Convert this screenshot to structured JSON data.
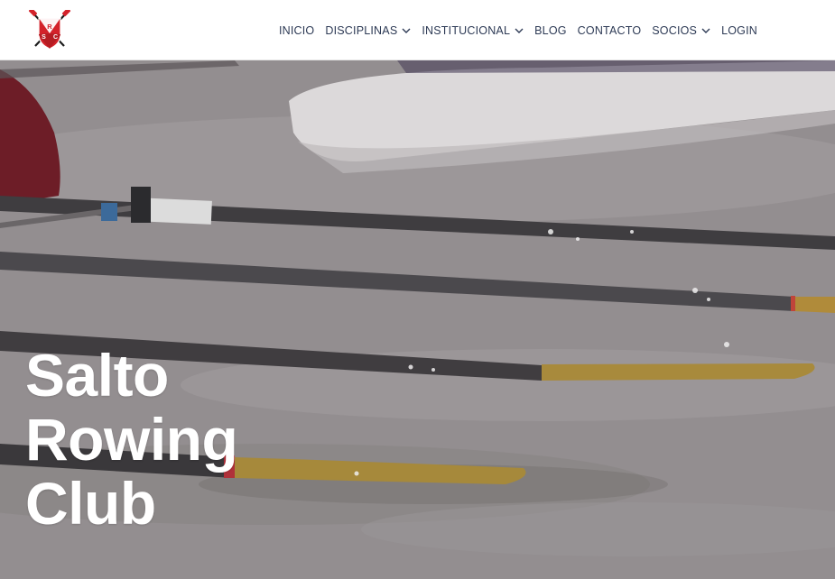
{
  "brand": {
    "logo_letters": [
      "S",
      "R",
      "C"
    ],
    "colors": {
      "red": "#d3222a",
      "dark": "#1c1c1c"
    }
  },
  "nav": {
    "items": [
      {
        "label": "INICIO",
        "dropdown": false
      },
      {
        "label": "DISCIPLINAS",
        "dropdown": true
      },
      {
        "label": "INSTITUCIONAL",
        "dropdown": true
      },
      {
        "label": "BLOG",
        "dropdown": false
      },
      {
        "label": "CONTACTO",
        "dropdown": false
      },
      {
        "label": "SOCIOS",
        "dropdown": true
      },
      {
        "label": "LOGIN",
        "dropdown": false
      }
    ],
    "text_color": "#2d3a55"
  },
  "hero": {
    "title_lines": [
      "Salto",
      "Rowing",
      "Club"
    ]
  }
}
